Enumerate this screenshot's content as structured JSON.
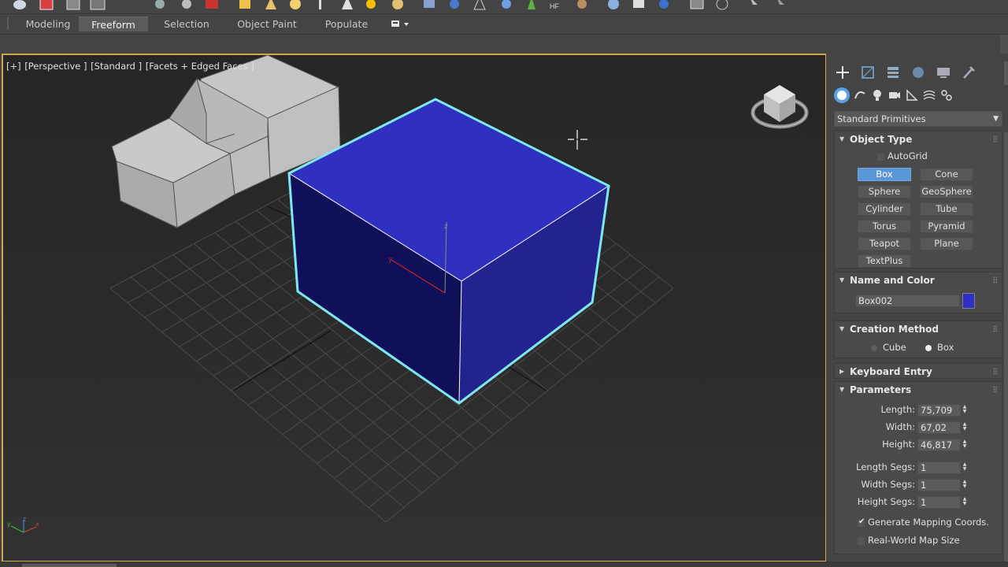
{
  "ribbon": {
    "tabs": [
      {
        "label": "Modeling",
        "active": false
      },
      {
        "label": "Freeform",
        "active": true
      },
      {
        "label": "Selection",
        "active": false
      },
      {
        "label": "Object Paint",
        "active": false
      },
      {
        "label": "Populate",
        "active": false
      }
    ]
  },
  "viewport": {
    "label_plus": "[+]",
    "label_view": "[Perspective ]",
    "label_shading": "[Standard ]",
    "label_mode": "[Facets + Edged Faces ]",
    "gizmo_labels": {
      "x": "x",
      "y": "y",
      "z": "z"
    }
  },
  "command_panel": {
    "category": "Standard Primitives",
    "object_type": {
      "title": "Object Type",
      "autogrid_label": "AutoGrid",
      "autogrid_checked": false,
      "buttons": [
        {
          "label": "Box",
          "active": true
        },
        {
          "label": "Cone",
          "active": false
        },
        {
          "label": "Sphere",
          "active": false
        },
        {
          "label": "GeoSphere",
          "active": false
        },
        {
          "label": "Cylinder",
          "active": false
        },
        {
          "label": "Tube",
          "active": false
        },
        {
          "label": "Torus",
          "active": false
        },
        {
          "label": "Pyramid",
          "active": false
        },
        {
          "label": "Teapot",
          "active": false
        },
        {
          "label": "Plane",
          "active": false
        },
        {
          "label": "TextPlus",
          "active": false
        }
      ]
    },
    "name_and_color": {
      "title": "Name and Color",
      "object_name": "Box002",
      "color": "#2f2fc8"
    },
    "creation_method": {
      "title": "Creation Method",
      "options": [
        {
          "label": "Cube",
          "selected": false
        },
        {
          "label": "Box",
          "selected": true
        }
      ]
    },
    "keyboard_entry": {
      "title": "Keyboard Entry"
    },
    "parameters": {
      "title": "Parameters",
      "length_label": "Length:",
      "length": "75,709",
      "width_label": "Width:",
      "width": "67,02",
      "height_label": "Height:",
      "height": "46,817",
      "length_segs_label": "Length Segs:",
      "length_segs": "1",
      "width_segs_label": "Width Segs:",
      "width_segs": "1",
      "height_segs_label": "Height Segs:",
      "height_segs": "1",
      "gen_mapping_label": "Generate Mapping Coords.",
      "gen_mapping_checked": true,
      "real_world_label": "Real-World Map Size",
      "real_world_checked": false
    }
  },
  "colors": {
    "selection_outline": "#7ee8f0",
    "box_top": "#3030c0",
    "box_front": "#10105a",
    "box_side": "#23238f",
    "active_button": "#5b97d6",
    "viewport_border": "#d1a74a"
  }
}
